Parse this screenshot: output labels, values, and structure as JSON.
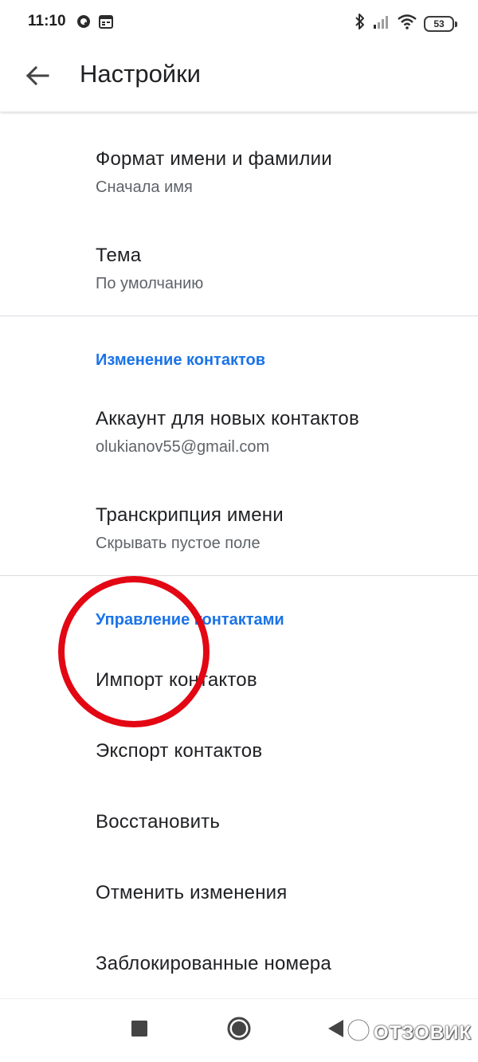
{
  "status_bar": {
    "time": "11:10",
    "battery_level": "53",
    "left_icons": [
      "q-app-icon",
      "calendar-icon"
    ],
    "right_icons": [
      "bluetooth-icon",
      "cellular-signal-icon",
      "wifi-icon",
      "battery-icon"
    ]
  },
  "app_bar": {
    "title": "Настройки",
    "back_icon": "arrow-left-icon"
  },
  "settings": {
    "name_format": {
      "title": "Формат имени и фамилии",
      "value": "Сначала имя"
    },
    "theme": {
      "title": "Тема",
      "value": "По умолчанию"
    },
    "section_editing": "Изменение контактов",
    "default_account": {
      "title": "Аккаунт для новых контактов",
      "value": "olukianov55@gmail.com"
    },
    "phonetic_name": {
      "title": "Транскрипция имени",
      "value": "Скрывать пустое поле"
    },
    "section_management": "Управление контактами",
    "import": {
      "title": "Импорт контактов"
    },
    "export": {
      "title": "Экспорт контактов"
    },
    "restore": {
      "title": "Восстановить"
    },
    "undo_changes": {
      "title": "Отменить изменения"
    },
    "blocked_numbers": {
      "title": "Заблокированные номера"
    }
  },
  "annotation": {
    "color": "#e30613",
    "shape": "circle",
    "highlights": "Импорт контактов"
  },
  "nav_bar": {
    "buttons": [
      "recents-square-icon",
      "home-circle-icon",
      "back-triangle-icon"
    ]
  },
  "watermark": {
    "text": "ОТЗОВИК"
  },
  "colors": {
    "accent": "#1a73e8",
    "primary_text": "#202124",
    "secondary_text": "#5f6368",
    "divider": "#dadce0"
  }
}
